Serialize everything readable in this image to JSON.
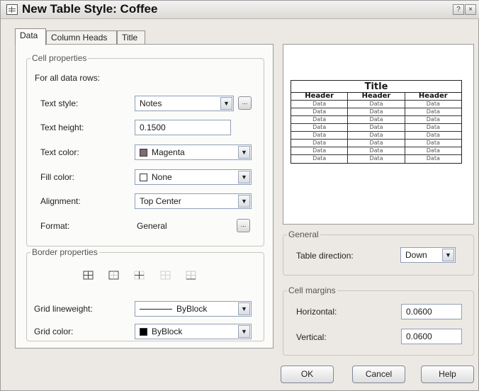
{
  "window": {
    "title": "New Table Style: Coffee",
    "help_btn": "?",
    "close_btn": "×"
  },
  "tabs": [
    {
      "label": "Data",
      "active": true
    },
    {
      "label": "Column Heads",
      "active": false
    },
    {
      "label": "Title",
      "active": false
    }
  ],
  "cell_properties": {
    "group_label": "Cell properties",
    "intro": "For all data rows:",
    "text_style": {
      "label": "Text style:",
      "value": "Notes",
      "browse": "..."
    },
    "text_height": {
      "label": "Text height:",
      "value": "0.1500"
    },
    "text_color": {
      "label": "Text color:",
      "value": "Magenta",
      "swatch": "#7b6d74"
    },
    "fill_color": {
      "label": "Fill color:",
      "value": "None",
      "swatch": "#ffffff"
    },
    "alignment": {
      "label": "Alignment:",
      "value": "Top Center"
    },
    "format": {
      "label": "Format:",
      "value": "General",
      "browse": "..."
    }
  },
  "border_properties": {
    "group_label": "Border properties",
    "buttons": [
      "all-borders-icon",
      "outside-borders-icon",
      "inside-borders-icon",
      "no-borders-icon",
      "bottom-border-icon"
    ],
    "grid_lineweight": {
      "label": "Grid lineweight:",
      "value": "ByBlock"
    },
    "grid_color": {
      "label": "Grid color:",
      "value": "ByBlock",
      "swatch": "#000000"
    }
  },
  "preview": {
    "title": "Title",
    "headers": [
      "Header",
      "Header",
      "Header"
    ],
    "rows": [
      [
        "Data",
        "Data",
        "Data"
      ],
      [
        "Data",
        "Data",
        "Data"
      ],
      [
        "Data",
        "Data",
        "Data"
      ],
      [
        "Data",
        "Data",
        "Data"
      ],
      [
        "Data",
        "Data",
        "Data"
      ],
      [
        "Data",
        "Data",
        "Data"
      ],
      [
        "Data",
        "Data",
        "Data"
      ],
      [
        "Data",
        "Data",
        "Data"
      ]
    ]
  },
  "general": {
    "group_label": "General",
    "table_direction": {
      "label": "Table direction:",
      "value": "Down"
    }
  },
  "cell_margins": {
    "group_label": "Cell margins",
    "horizontal": {
      "label": "Horizontal:",
      "value": "0.0600"
    },
    "vertical": {
      "label": "Vertical:",
      "value": "0.0600"
    }
  },
  "buttons": {
    "ok": "OK",
    "cancel": "Cancel",
    "help": "Help"
  }
}
